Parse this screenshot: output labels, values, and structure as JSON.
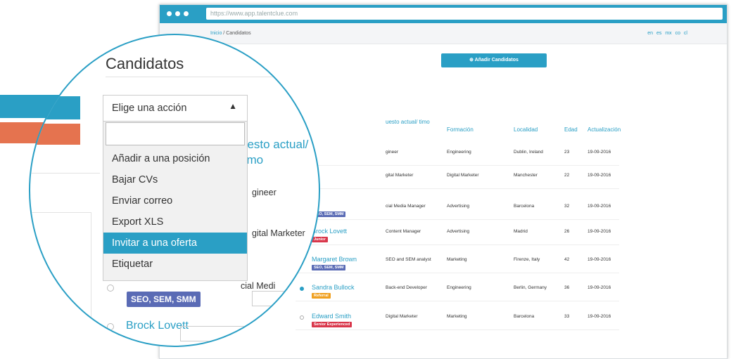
{
  "browser": {
    "url": "https://www.app.talentclue.com"
  },
  "breadcrumb": {
    "home": "Inicio",
    "sep": " / ",
    "current": "Candidatos"
  },
  "languages": "en es mx co cl",
  "page": {
    "title": "Candidatos",
    "add_button": "Añadir Candidatos"
  },
  "action_dropdown": {
    "label": "Elige una acción",
    "options": [
      "Añadir a una posición",
      "Bajar CVs",
      "Enviar correo",
      "Export XLS",
      "Invitar a una oferta",
      "Etiquetar"
    ],
    "selected": "Invitar a una oferta"
  },
  "table": {
    "headers": {
      "position": "uesto actual/ timo",
      "training": "Formación",
      "location": "Localidad",
      "age": "Edad",
      "updated": "Actualización"
    },
    "rows": [
      {
        "name": "",
        "tag": "",
        "position": "gineer",
        "training": "Engineering",
        "location": "Dublin, Ireland",
        "age": "23",
        "updated": "19-09-2016"
      },
      {
        "name": "",
        "tag": "",
        "position": "gital Marketer",
        "training": "Digital Marketer",
        "location": "Manchester",
        "age": "22",
        "updated": "19-09-2016"
      },
      {
        "name": "",
        "tag": "SEO, SEM, SMM",
        "position": "cial Media Manager",
        "training": "Advertising",
        "location": "Barcelona",
        "age": "32",
        "updated": "19-09-2016"
      },
      {
        "name": "Brock Lovett",
        "tag": "Junior",
        "position": "Content Manager",
        "training": "Advertising",
        "location": "Madrid",
        "age": "26",
        "updated": "19-09-2016"
      },
      {
        "name": "Margaret Brown",
        "tag": "SEO, SEM, SMM",
        "position": "SEO and SEM analyst",
        "training": "Marketing",
        "location": "Firenze, Italy",
        "age": "42",
        "updated": "19-09-2016"
      },
      {
        "name": "Sandra Bullock",
        "tag": "Referral",
        "position": "Back-end Developer",
        "training": "Engineering",
        "location": "Berlin, Germany",
        "age": "36",
        "updated": "19-09-2016"
      },
      {
        "name": "Edward Smith",
        "tag": "Senior Experienced",
        "position": "Digital Marketer",
        "training": "Marketing",
        "location": "Barcelona",
        "age": "33",
        "updated": "19-09-2016"
      }
    ]
  },
  "zoom": {
    "header": "uesto actual/",
    "header2": "timo",
    "row1": "gineer",
    "row2": "gital Marketer",
    "row3": "cial Medi",
    "tag": "SEO, SEM, SMM",
    "name": "Brock Lovett"
  },
  "colors": {
    "accent": "#2a9fc5",
    "orange": "#e5734f",
    "tag_purple": "#5a6bb5",
    "tag_red": "#d9374b",
    "tag_orange": "#f0a020"
  }
}
